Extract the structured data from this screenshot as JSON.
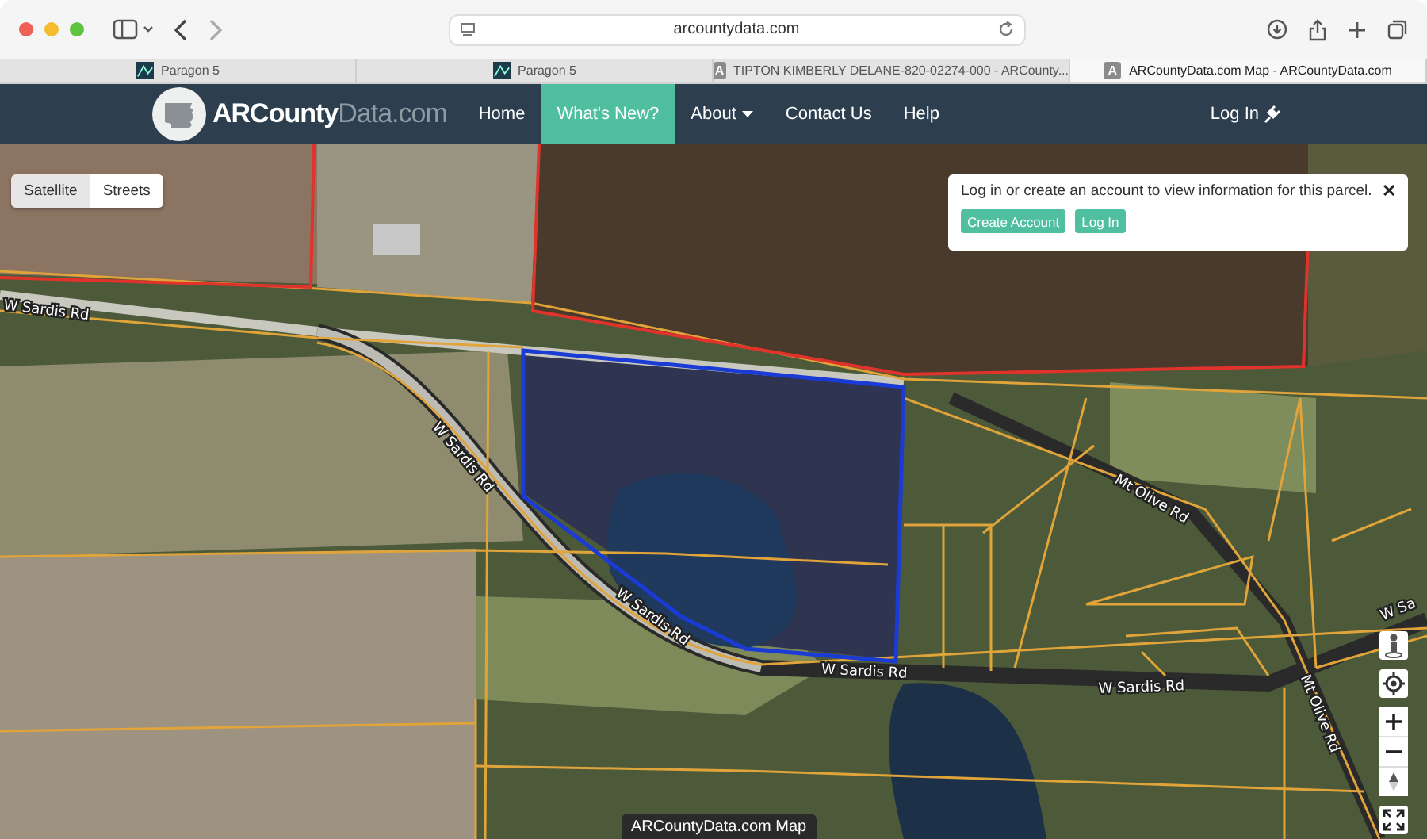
{
  "browser": {
    "address": "arcountydata.com",
    "tabs": [
      {
        "label": "Paragon 5",
        "kind": "chart",
        "selected": false
      },
      {
        "label": "Paragon 5",
        "kind": "chart",
        "selected": false
      },
      {
        "label": "TIPTON KIMBERLY DELANE-820-02274-000 - ARCounty...",
        "kind": "letter",
        "icon_text": "A",
        "selected": false
      },
      {
        "label": "ARCountyData.com Map - ARCountyData.com",
        "kind": "letter",
        "icon_text": "A",
        "selected": true
      }
    ]
  },
  "navbar": {
    "logo_primary": "ARCounty",
    "logo_secondary": "Data.com",
    "items": [
      {
        "label": "Home",
        "selected": false,
        "dropdown": false
      },
      {
        "label": "What's New?",
        "selected": true,
        "dropdown": false
      },
      {
        "label": "About",
        "selected": false,
        "dropdown": true
      },
      {
        "label": "Contact Us",
        "selected": false,
        "dropdown": false
      },
      {
        "label": "Help",
        "selected": false,
        "dropdown": false
      }
    ],
    "login": "Log In"
  },
  "map": {
    "layers": [
      {
        "label": "Satellite",
        "selected": true
      },
      {
        "label": "Streets",
        "selected": false
      }
    ],
    "notice": {
      "message": "Log in or create an account to view information for this parcel.",
      "close": "✕",
      "buttons": [
        "Create Account",
        "Log In"
      ]
    },
    "road_labels": [
      "W Sardis Rd",
      "W Sardis Rd",
      "W Sardis Rd",
      "W Sardis Rd",
      "W Sardis Rd",
      "Mt Olive Rd",
      "Mt Olive Rd",
      "W Sa"
    ],
    "caption": "ARCountyData.com Map"
  }
}
